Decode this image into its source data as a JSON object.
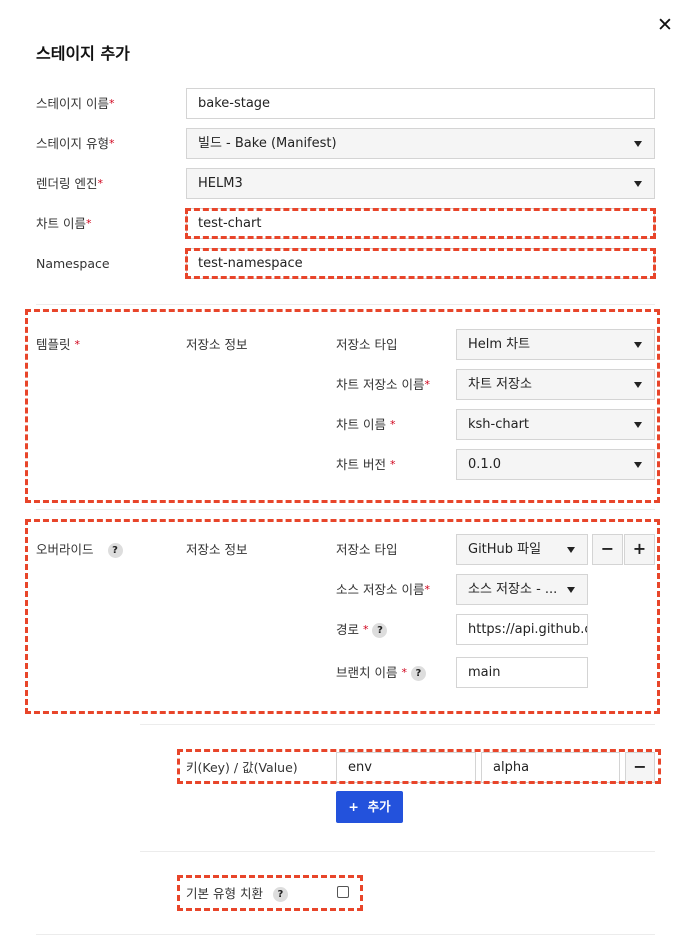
{
  "dialog": {
    "title": "스테이지 추가",
    "close_icon": "close-icon"
  },
  "fields": {
    "stage_name": {
      "label": "스테이지 이름",
      "value": "bake-stage"
    },
    "stage_type": {
      "label": "스테이지 유형",
      "value": "빌드 - Bake (Manifest)"
    },
    "render_engine": {
      "label": "렌더링 엔진",
      "value": "HELM3"
    },
    "chart_name": {
      "label": "차트 이름",
      "value": "test-chart"
    },
    "namespace": {
      "label": "Namespace",
      "value": "test-namespace"
    }
  },
  "template": {
    "label": "템플릿",
    "repo_info": "저장소 정보",
    "rows": [
      {
        "label": "저장소 타입",
        "value": "Helm 차트",
        "required": false
      },
      {
        "label": "차트 저장소 이름",
        "value": "차트 저장소",
        "required": true
      },
      {
        "label": "차트 이름",
        "value": "ksh-chart",
        "required": true
      },
      {
        "label": "차트 버전",
        "value": "0.1.0",
        "required": true
      }
    ]
  },
  "override": {
    "label": "오버라이드",
    "repo_info": "저장소 정보",
    "repo_type": {
      "label": "저장소 타입",
      "value": "GitHub 파일"
    },
    "source_repo": {
      "label": "소스 저장소 이름",
      "value": "소스 저장소 - ..."
    },
    "path": {
      "label": "경로",
      "value": "https://api.github.com"
    },
    "branch": {
      "label": "브랜치 이름",
      "value": "main"
    },
    "minus": "−",
    "plus": "+"
  },
  "kv": {
    "label": "키(Key) / 값(Value)",
    "key": "env",
    "value": "alpha",
    "remove": "−",
    "add_label": "추가",
    "add_icon": "+"
  },
  "replace": {
    "label": "기본 유형 치환",
    "checked": false
  },
  "help": "?",
  "required_mark": "*"
}
